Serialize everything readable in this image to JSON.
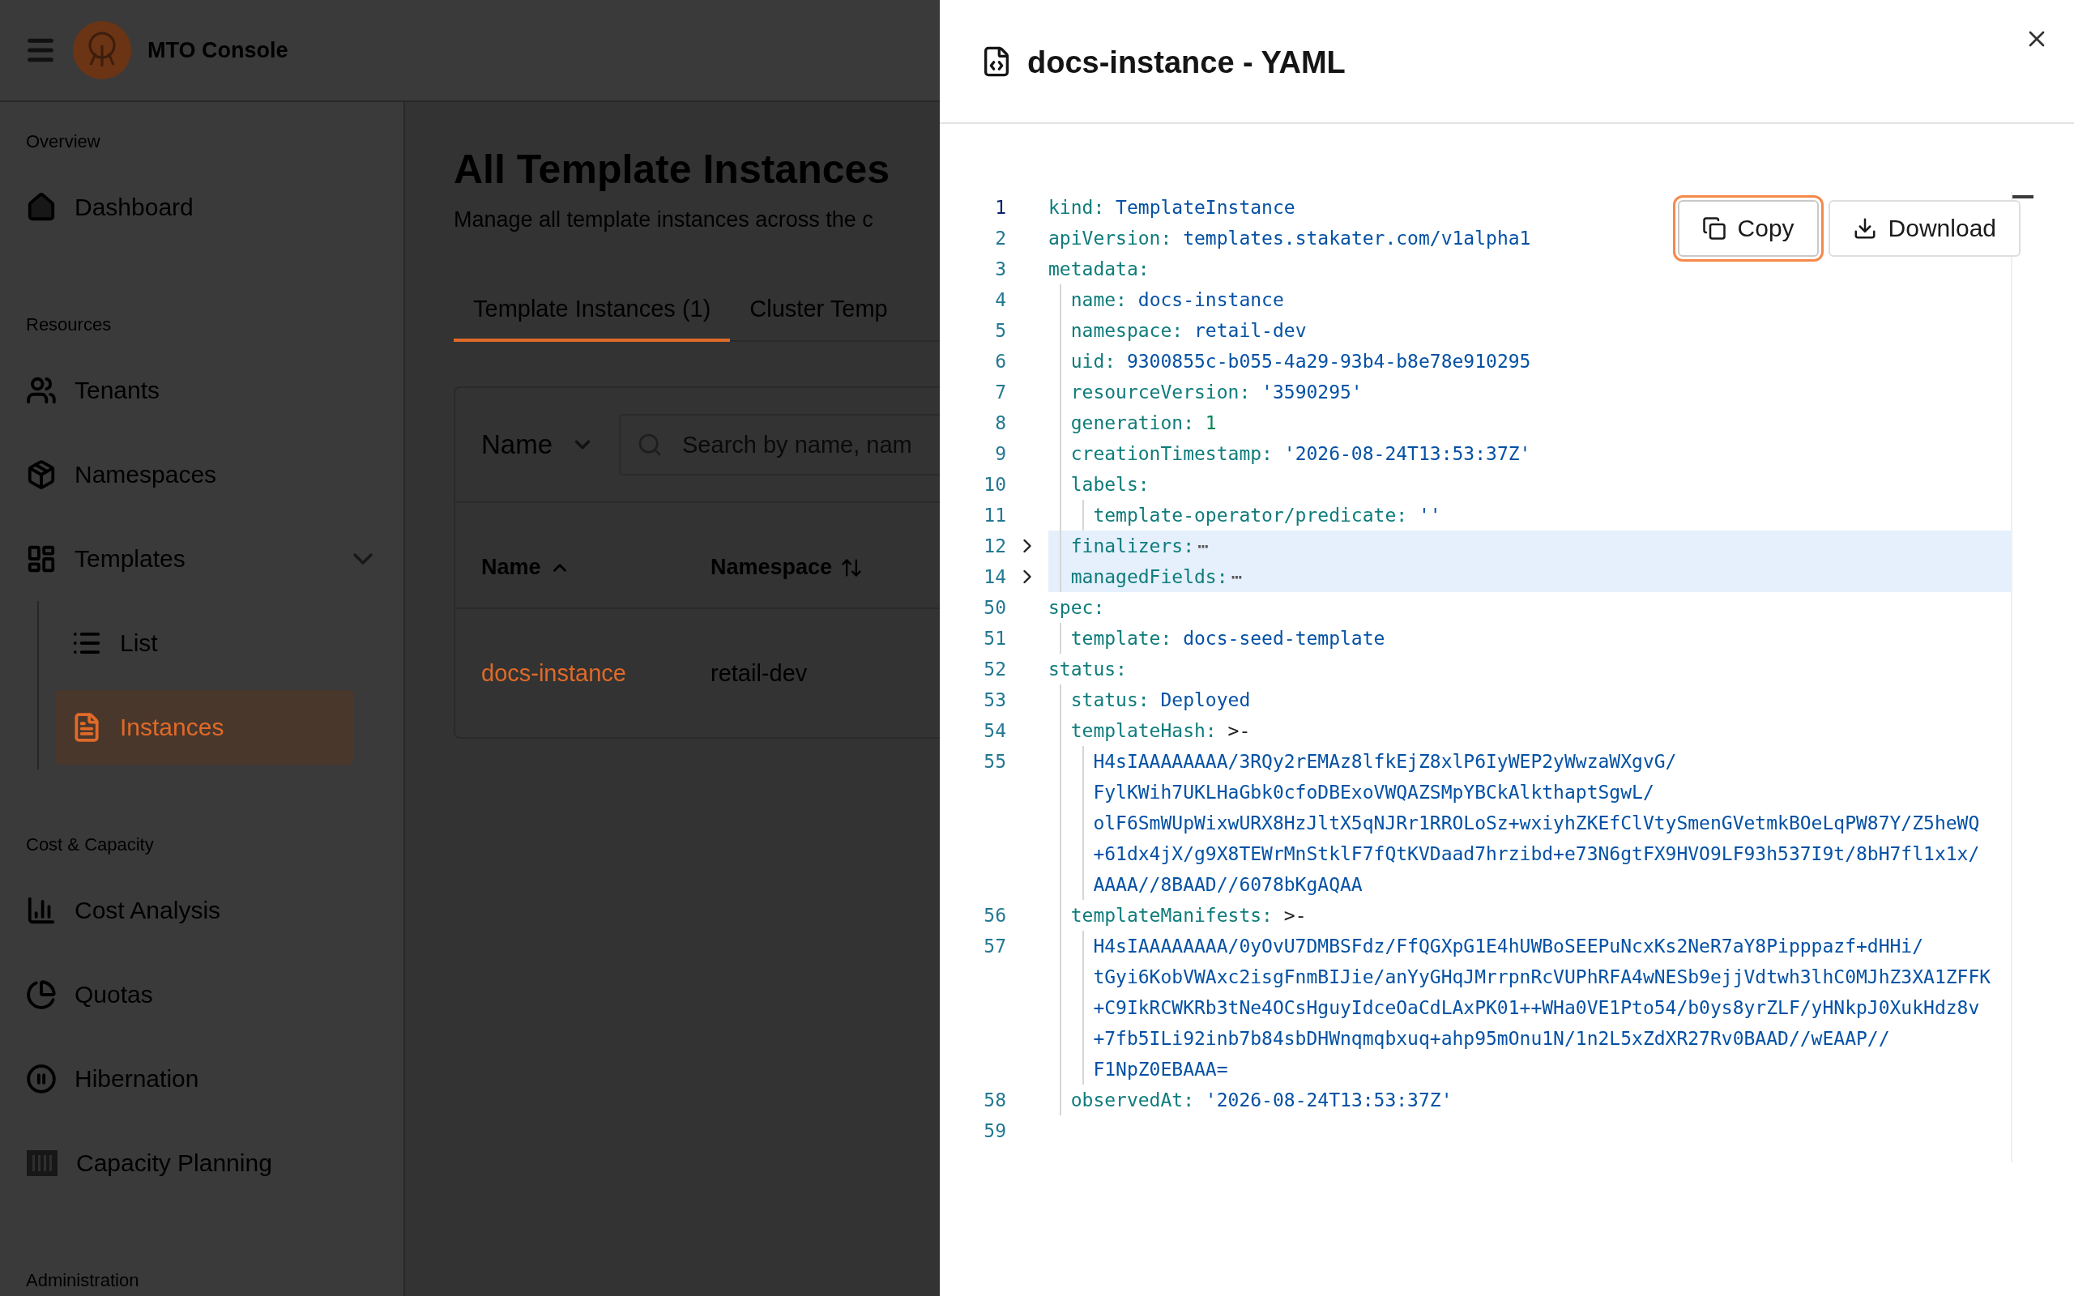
{
  "header": {
    "app_name": "MTO Console"
  },
  "sidebar": {
    "sections": [
      {
        "label": "Overview",
        "items": [
          {
            "label": "Dashboard",
            "kind": "home",
            "selected": false
          }
        ]
      },
      {
        "label": "Resources",
        "items": [
          {
            "label": "Tenants",
            "kind": "users",
            "selected": false
          },
          {
            "label": "Namespaces",
            "kind": "package",
            "selected": false
          },
          {
            "label": "Templates",
            "kind": "grid",
            "selected": false,
            "expanded": true,
            "children": [
              {
                "label": "List",
                "kind": "list",
                "selected": false
              },
              {
                "label": "Instances",
                "kind": "file",
                "selected": true
              }
            ]
          }
        ]
      },
      {
        "label": "Cost & Capacity",
        "items": [
          {
            "label": "Cost Analysis",
            "kind": "bars",
            "selected": false
          },
          {
            "label": "Quotas",
            "kind": "pie",
            "selected": false
          },
          {
            "label": "Hibernation",
            "kind": "pause",
            "selected": false
          },
          {
            "label": "Capacity Planning",
            "kind": "columns",
            "selected": false
          }
        ]
      },
      {
        "label": "Administration"
      }
    ]
  },
  "page": {
    "title": "All Template Instances",
    "subtitle": "Manage all template instances across the c",
    "tabs": [
      {
        "label": "Template Instances (1)",
        "selected": true
      },
      {
        "label": "Cluster Temp",
        "selected": false
      }
    ],
    "filter": {
      "field": "Name",
      "search_placeholder": "Search by name, nam"
    },
    "table": {
      "columns": [
        {
          "label": "Name",
          "sorted": true
        },
        {
          "label": "Namespace",
          "sorted": false
        }
      ],
      "rows": [
        {
          "cells": [
            "docs-instance",
            "retail-dev"
          ]
        }
      ]
    }
  },
  "drawer": {
    "title": "docs-instance - YAML",
    "actions": [
      {
        "label": "Copy",
        "kind": "copy",
        "focused": true
      },
      {
        "label": "Download",
        "kind": "download",
        "focused": false
      }
    ],
    "yaml": [
      {
        "num": "1",
        "key": "kind:",
        "value": "TemplateInstance",
        "kind": "string"
      },
      {
        "num": "2",
        "key": "apiVersion:",
        "value": "templates.stakater.com/v1alpha1",
        "kind": "string"
      },
      {
        "num": "3",
        "key": "metadata:",
        "children": [
          {
            "num": "4",
            "key": "name:",
            "value": "docs-instance",
            "kind": "string"
          },
          {
            "num": "5",
            "key": "namespace:",
            "value": "retail-dev",
            "kind": "string"
          },
          {
            "num": "6",
            "key": "uid:",
            "value": "9300855c-b055-4a29-93b4-b8e78e910295",
            "kind": "string"
          },
          {
            "num": "7",
            "key": "resourceVersion:",
            "value": "'3590295'",
            "kind": "string"
          },
          {
            "num": "8",
            "key": "generation:",
            "value": "1",
            "kind": "number"
          },
          {
            "num": "9",
            "key": "creationTimestamp:",
            "value": "'2026-08-24T13:53:37Z'",
            "kind": "string"
          },
          {
            "num": "10",
            "key": "labels:",
            "children": [
              {
                "num": "11",
                "key": "template-operator/predicate:",
                "value": "''",
                "kind": "string"
              }
            ]
          },
          {
            "num": "12",
            "key": "finalizers:",
            "folded": true,
            "collapsed_text": "⋯"
          },
          {
            "num": "14",
            "key": "managedFields:",
            "folded": true,
            "collapsed_text": "⋯"
          }
        ]
      },
      {
        "num": "50",
        "key": "spec:",
        "children": [
          {
            "num": "51",
            "key": "template:",
            "value": "docs-seed-template",
            "kind": "string"
          }
        ]
      },
      {
        "num": "52",
        "key": "status:",
        "children": [
          {
            "num": "53",
            "key": "status:",
            "value": "Deployed",
            "kind": "string"
          },
          {
            "num": "54",
            "key": "templateHash:",
            "value": ">-",
            "kind": "indicator",
            "block": {
              "num": "55",
              "lines": [
                "H4sIAAAAAAAA/3RQy2rEMAz8lfkEjZ8xlP6IyWEP2yWwzaWXgvG/",
                "FylKWih7UKLHaGbk0cfoDBExoVWQAZSMpYBCkAlkthaptSgwL/",
                "olF6SmWUpWixwURX8HzJltX5qNJRr1RROLoSz+wxiyhZKEfClVtySmenGVetmkBOeLqPW87Y/Z5heWQ",
                "+61dx4jX/g9X8TEWrMnStklF7fQtKVDaad7hrzibd+e73N6gtFX9HVO9LF93h537I9t/8bH7fl1x1x/",
                "AAAA//8BAAD//6078bKgAQAA"
              ]
            }
          },
          {
            "num": "56",
            "key": "templateManifests:",
            "value": ">-",
            "kind": "indicator",
            "block": {
              "num": "57",
              "lines": [
                "H4sIAAAAAAAA/0yOvU7DMBSFdz/FfQGXpG1E4hUWBoSEEPuNcxKs2NeR7aY8Pipppazf+dHHi/",
                "tGyi6KobVWAxc2isgFnmBIJie/anYyGHqJMrrpnRcVUPhRFA4wNESb9ejjVdtwh3lhC0MJhZ3XA1ZFFK",
                "+C9IkRCWKRb3tNe4OCsHguyIdceOaCdLAxPK01++WHa0VE1Pto54/b0ys8yrZLF/yHNkpJ0XukHdz8v",
                "+7fb5ILi92inb7b84sbDHWnqmqbxuq+ahp95mOnu1N/1n2L5xZdXR27Rv0BAAD//wEAAP//",
                "F1NpZ0EBAAA="
              ]
            }
          },
          {
            "num": "58",
            "key": "observedAt:",
            "value": "'2026-08-24T13:53:37Z'",
            "kind": "string"
          }
        ]
      },
      {
        "num": "59"
      }
    ]
  }
}
